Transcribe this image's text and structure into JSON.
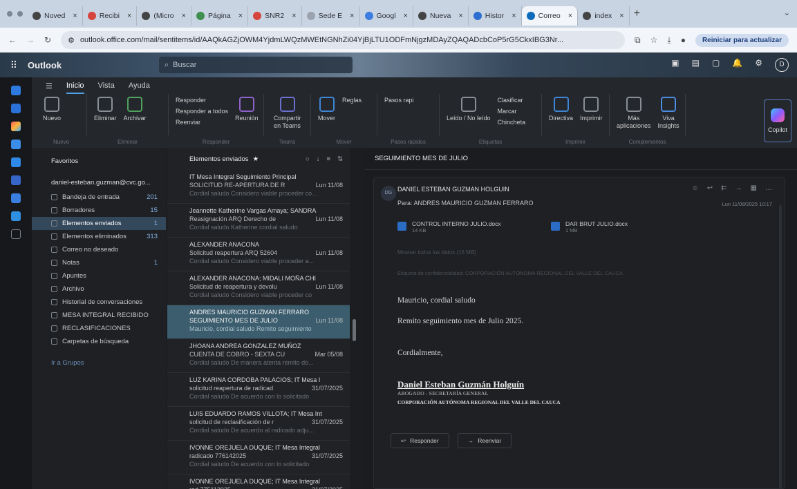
{
  "browser": {
    "tabs": [
      {
        "label": "Noved",
        "color": "#444444"
      },
      {
        "label": "Recibi",
        "color": "#d6453d"
      },
      {
        "label": "(Micro",
        "color": "#444444"
      },
      {
        "label": "Página",
        "color": "#3f8f4f"
      },
      {
        "label": "SNR2",
        "color": "#d6453d"
      },
      {
        "label": "Sede E",
        "color": "#9aa3ad"
      },
      {
        "label": "Googl",
        "color": "#3b7de0"
      },
      {
        "label": "Nueva",
        "color": "#444444"
      },
      {
        "label": "Histor",
        "color": "#2d6fd0"
      },
      {
        "label": "Correo",
        "color": "#0f6cbd"
      },
      {
        "label": "index",
        "color": "#444444"
      }
    ],
    "url": "outlook.office.com/mail/sentitems/id/AAQkAGZjOWM4YjdmLWQzMWEtNGNhZi04YjBjLTU1ODFmNjgzMDAyZQAQADcbCoP5rG5CkxIBG3Nr...",
    "update_label": "Reiniciar para actualizar"
  },
  "outlook": {
    "brand": "Outlook",
    "search_placeholder": "Buscar"
  },
  "ribbon": {
    "tabs": [
      "Inicio",
      "Vista",
      "Ayuda"
    ],
    "new_label": "Nuevo",
    "delete_label": "Eliminar",
    "archive_label": "Archivar",
    "reply_label": "Responder",
    "reply_all_label": "Responder a todos",
    "forward_label": "Reenviar",
    "meeting_label": "Reunión",
    "teams_label": "Compartir en Teams",
    "move_label": "Mover",
    "rules_label": "Reglas",
    "quicksteps_label": "Pasos rapi",
    "read_label": "Leído / No leído",
    "classify_label": "Clasificar",
    "flag_label": "Marcar",
    "pin_label": "Chincheta",
    "policy_label": "Directiva",
    "print_label": "Imprimir",
    "apps_label": "Más aplicaciones",
    "viva_label": "Viva Insights",
    "copilot_label": "Copilot",
    "groups": [
      "Nuevo",
      "Eliminar",
      "Responder",
      "Teams",
      "Mover",
      "Pasos rápidos",
      "Etiquetas",
      "Imprimir",
      "Complementos"
    ]
  },
  "folders": {
    "favorites": "Favoritos",
    "account": "daniel-esteban.guzman@cvc.go...",
    "items": [
      {
        "label": "Bandeja de entrada",
        "count": "201"
      },
      {
        "label": "Borradores",
        "count": "15"
      },
      {
        "label": "Elementos enviados",
        "count": "1"
      },
      {
        "label": "Elementos eliminados",
        "count": "313"
      },
      {
        "label": "Correo no deseado",
        "count": ""
      },
      {
        "label": "Notas",
        "count": "1"
      },
      {
        "label": "Apuntes",
        "count": ""
      },
      {
        "label": "Archivo",
        "count": ""
      },
      {
        "label": "Historial de conversaciones",
        "count": ""
      },
      {
        "label": "MESA INTEGRAL RECIBIDO",
        "count": ""
      },
      {
        "label": "RECLASIFICACIONES",
        "count": ""
      },
      {
        "label": "Carpetas de búsqueda",
        "count": ""
      }
    ],
    "groups_link": "Ir a Grupos"
  },
  "list": {
    "title": "Elementos enviados",
    "messages": [
      {
        "from": "IT Mesa Integral Seguimiento Principal",
        "subject": "SOLICITUD RE-APERTURA DE R",
        "date": "Lun 11/08",
        "preview": "Cordial saludo Considero viable proceder co..."
      },
      {
        "from": "Jeannette Katherine Vargas Amaya; SANDRA",
        "subject": "Reasignación ARQ Derecho de",
        "date": "Lun 11/08",
        "preview": "Cordial saludo Katherine cordial saludo"
      },
      {
        "from": "ALEXANDER ANACONA",
        "subject": "Solicitud reapertura ARQ 52604",
        "date": "Lun 11/08",
        "preview": "Cordial saludo Considero viable proceder a..."
      },
      {
        "from": "ALEXANDER ANACONA; MIDALI MOÑA CHI",
        "subject": "Solicitud de reapertura y devolu",
        "date": "Lun 11/08",
        "preview": "Cordial saludo Considero viable proceder co"
      },
      {
        "from": "ANDRES MAURICIO GUZMAN FERRARO",
        "subject": "SEGUIMIENTO MES DE JULIO",
        "date": "Lun 11/08",
        "preview": "Mauricio, cordial saludo Remito seguimiento"
      },
      {
        "from": "JHOANA ANDREA GONZALEZ MUÑOZ",
        "subject": "CUENTA DE COBRO - SEXTA CU",
        "date": "Mar 05/08",
        "preview": "Cordial saludo De manera atenta remito do..."
      },
      {
        "from": "LUZ KARINA CORDOBA PALACIOS; IT Mesa I",
        "subject": "solicitud reapertura de radicad",
        "date": "31/07/2025",
        "preview": "Cordial saludo De acuerdo con lo solicitado"
      },
      {
        "from": "LUIS EDUARDO RAMOS VILLOTA; IT Mesa Int",
        "subject": "solicitud de reclasificación de r",
        "date": "31/07/2025",
        "preview": "Cordial saludo De acuerdo al radicado adju..."
      },
      {
        "from": "IVONNE OREJUELA DUQUE; IT Mesa Integral",
        "subject": "radicado 776142025",
        "date": "31/07/2025",
        "preview": "Cordial saludo De acuerdo con lo solicitado"
      },
      {
        "from": "IVONNE OREJUELA DUQUE; IT Mesa Integral",
        "subject": "rad 775112025",
        "date": "31/07/2025",
        "preview": ""
      }
    ]
  },
  "reader": {
    "subject": "SEGUIMIENTO MES DE JULIO",
    "avatar": "DG",
    "sender": "DANIEL ESTEBAN GUZMAN HOLGUIN",
    "to_label": "Para:",
    "to": "ANDRES MAURICIO GUZMAN FERRARO",
    "timestamp": "Lun 11/08/2025 10:17",
    "attachments": [
      {
        "name": "CONTROL INTERNO JULIO.docx",
        "size": "14 KB"
      },
      {
        "name": "DAR BRUT JULIO.docx",
        "size": "1 MB"
      }
    ],
    "show_all": "Mostrar todos los datos (16 MB)",
    "sensitivity": "Etiqueta de confidencialidad: CORPORACIÓN AUTÓNOMA REGIONAL DEL VALLE DEL CAUCA",
    "greeting": "Mauricio, cordial saludo",
    "line1": "Remito seguimiento mes de Julio 2025.",
    "closing": "Cordialmente,",
    "sig_name": "Daniel Esteban Guzmán Holguín",
    "sig_title": "ABOGADO - SECRETARÍA GENERAL",
    "sig_org": "CORPORACIÓN AUTÓNOMA REGIONAL DEL VALLE DEL CAUCA",
    "reply_btn": "Responder",
    "forward_btn": "Reenviar"
  }
}
